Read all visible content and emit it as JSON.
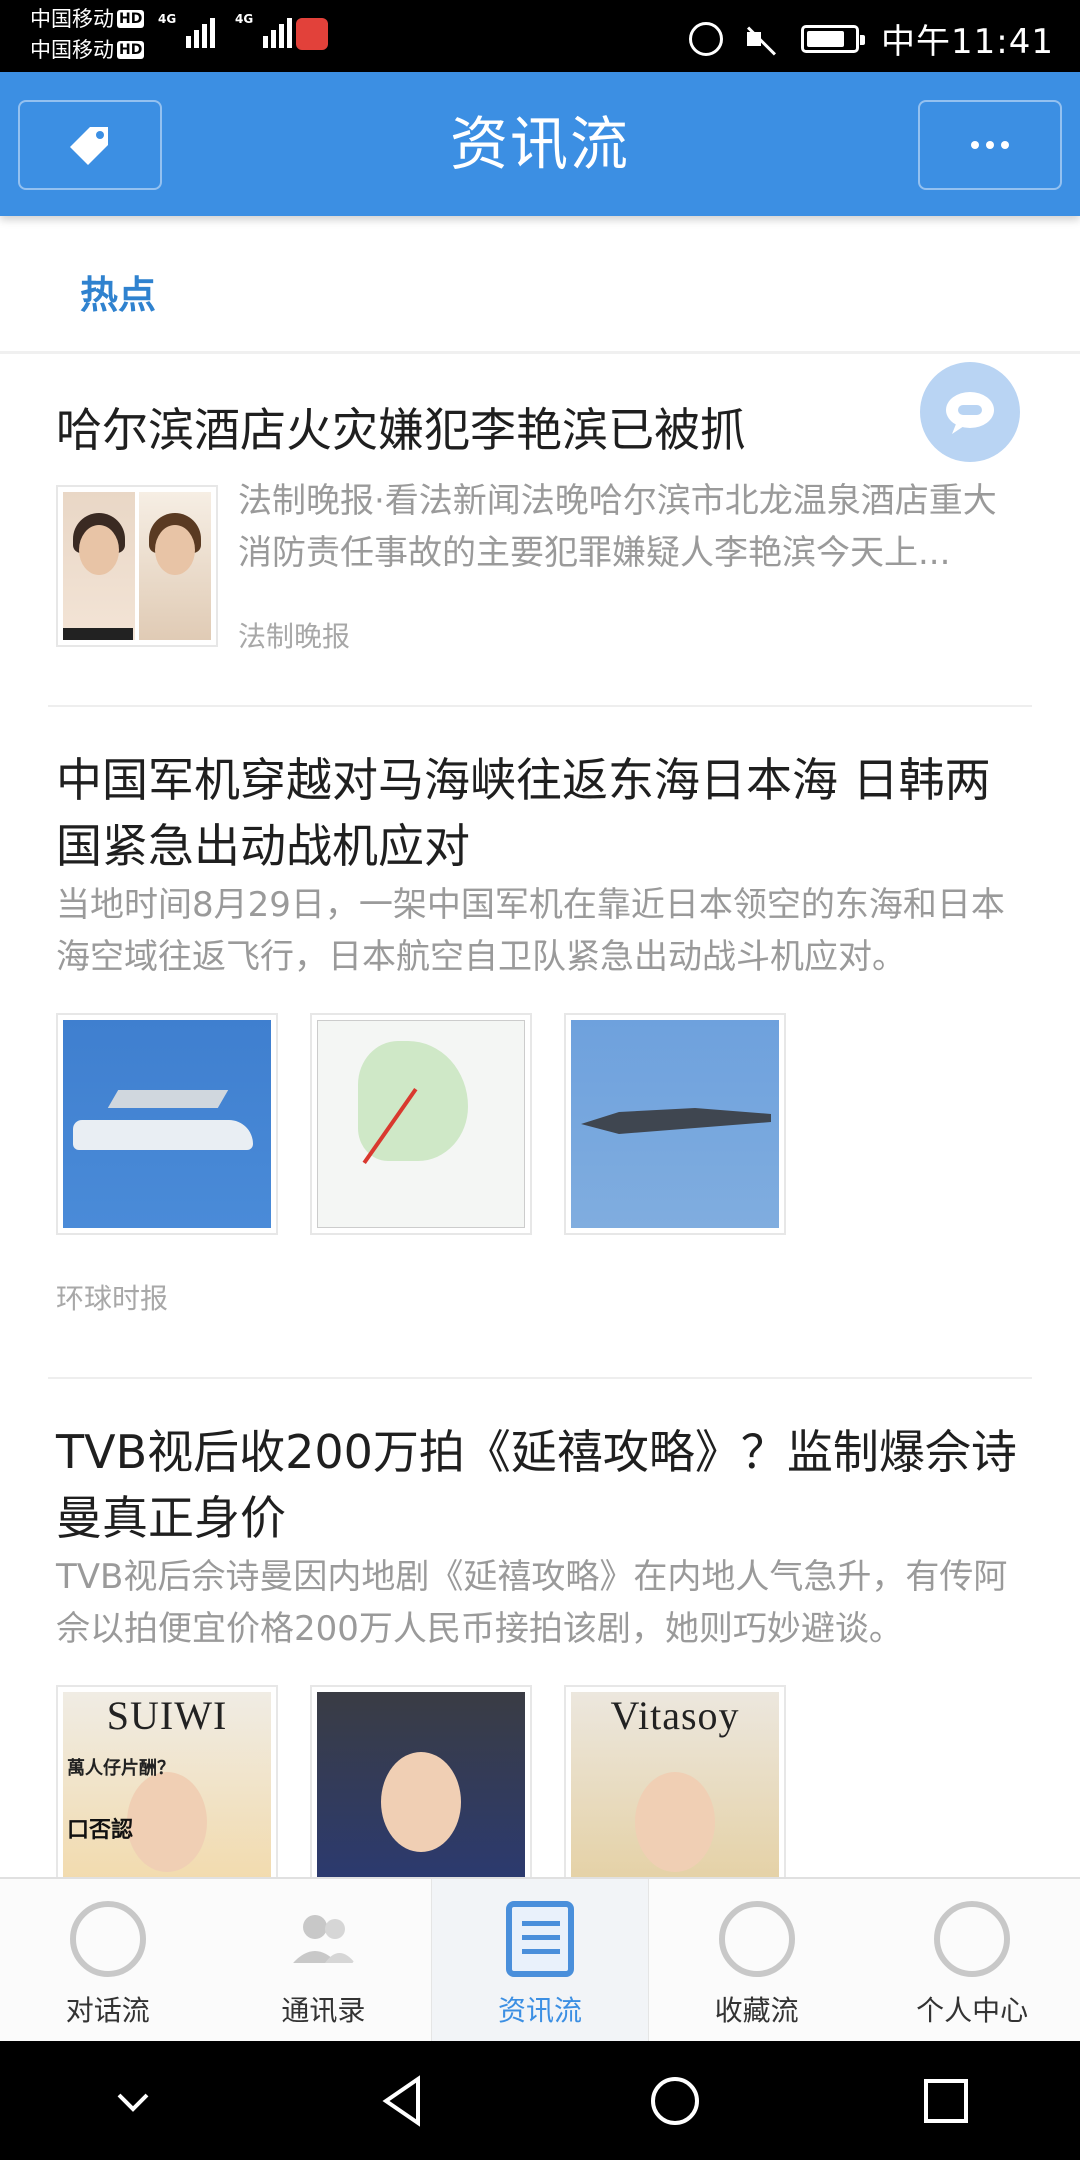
{
  "status_bar": {
    "carrier1": "中国移动",
    "carrier2": "中国移动",
    "hd": "HD",
    "net1": "4G",
    "net2": "4G",
    "battery_level": 0.8,
    "time": "中午11:41"
  },
  "header": {
    "title": "资讯流"
  },
  "tabs": {
    "active": "热点"
  },
  "feed": [
    {
      "title": "哈尔滨酒店火灾嫌犯李艳滨已被抓",
      "summary": "法制晚报·看法新闻法晚哈尔滨市北龙温泉酒店重大消防责任事故的主要犯罪嫌疑人李艳滨今天上...",
      "source": "法制晚报"
    },
    {
      "title": "中国军机穿越对马海峡往返东海日本海 日韩两国紧急出动战机应对",
      "summary": "当地时间8月29日，一架中国军机在靠近日本领空的东海和日本海空域往返飞行，日本航空自卫队紧急出动战斗机应对。",
      "source": "环球时报"
    },
    {
      "title": "TVB视后收200万拍《延禧攻略》？监制爆佘诗曼真正身价",
      "summary": "TVB视后佘诗曼因内地剧《延禧攻略》在内地人气急升，有传阿佘以拍便宜价格200万人民币接拍该剧，她则巧妙避谈。",
      "poster1_text": "SUIWI",
      "poster1_caption": "口否認",
      "poster1_tag": "萬人仔片酬？",
      "poster3_text": "Vitasoy"
    }
  ],
  "bottom_nav": [
    {
      "label": "对话流",
      "icon": "chat-bubble-icon"
    },
    {
      "label": "通讯录",
      "icon": "contacts-icon"
    },
    {
      "label": "资讯流",
      "icon": "news-feed-icon"
    },
    {
      "label": "收藏流",
      "icon": "favorites-icon"
    },
    {
      "label": "个人中心",
      "icon": "profile-icon"
    }
  ],
  "colors": {
    "primary": "#3c8fe3",
    "tab_active": "#2f82cf",
    "fab": "#b9d4f3"
  }
}
